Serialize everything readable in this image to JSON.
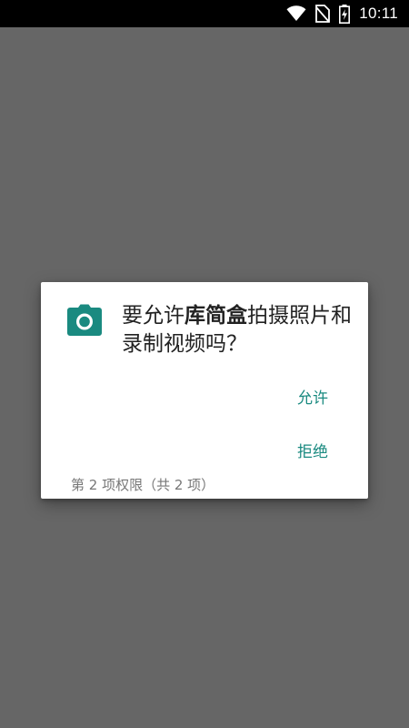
{
  "status_bar": {
    "time": "10:11",
    "icons": [
      "wifi-icon",
      "no-sim-icon",
      "battery-charging-icon"
    ]
  },
  "dialog": {
    "icon": "camera-icon",
    "accent_color": "#1a8a80",
    "title_prefix": "要允许",
    "app_name": "库简盒",
    "title_suffix": "拍摄照片和录制视频吗？",
    "allow_label": "允许",
    "deny_label": "拒绝",
    "counter": "第 2 项权限（共 2 项）"
  }
}
